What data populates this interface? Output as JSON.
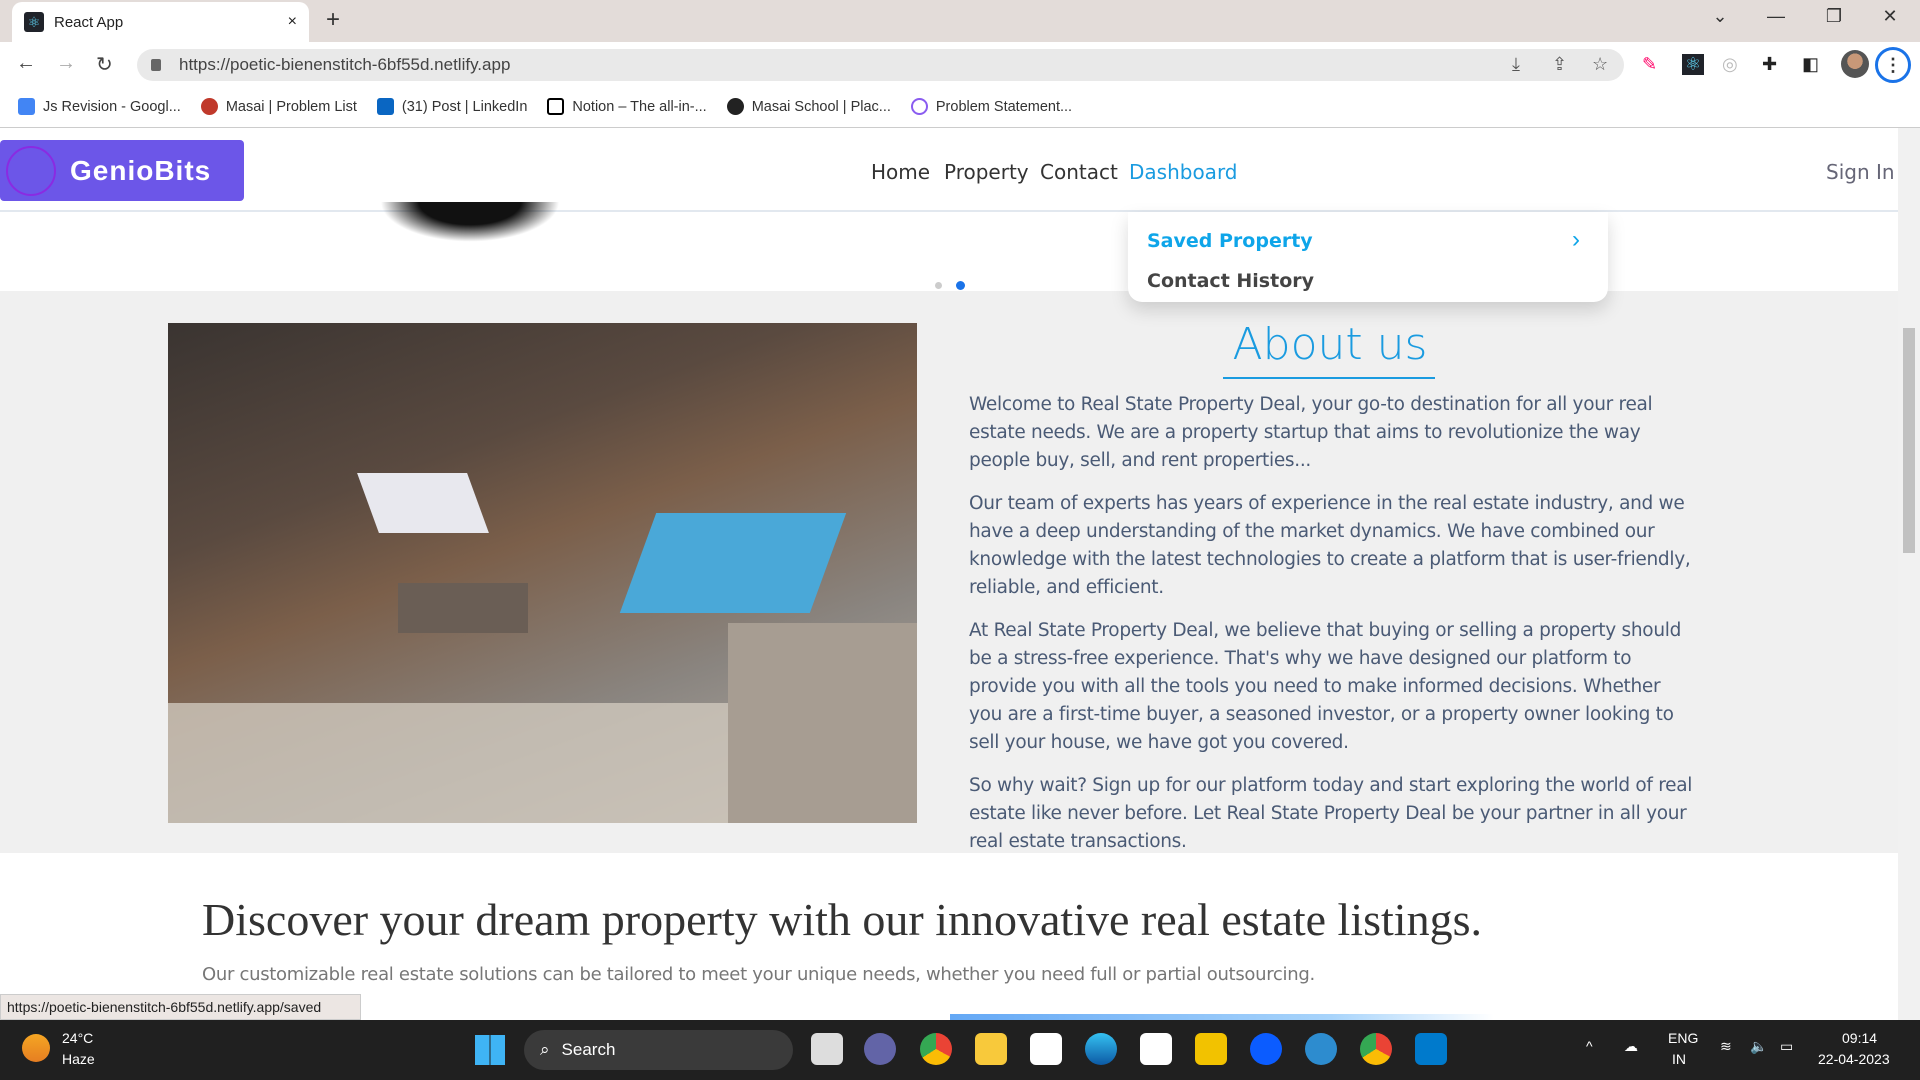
{
  "browser": {
    "tab_title": "React App",
    "tab_close": "×",
    "new_tab": "+",
    "url": "https://poetic-bienenstitch-6bf55d.netlify.app",
    "status_url": "https://poetic-bienenstitch-6bf55d.netlify.app/saved",
    "bookmarks": [
      {
        "label": "Js Revision - Googl...",
        "icon": "google-docs-icon",
        "color": "#4285f4"
      },
      {
        "label": "Masai | Problem List",
        "icon": "masai-icon",
        "color": "#c0392b"
      },
      {
        "label": "(31) Post | LinkedIn",
        "icon": "linkedin-icon",
        "color": "#0a66c2"
      },
      {
        "label": "Notion – The all-in-...",
        "icon": "notion-icon",
        "color": "#000000"
      },
      {
        "label": "Masai School | Plac...",
        "icon": "globe-icon",
        "color": "#222222"
      },
      {
        "label": "Problem Statement...",
        "icon": "network-icon",
        "color": "#8a5cf0"
      }
    ]
  },
  "site": {
    "logo": "GenioBits",
    "nav": [
      {
        "label": "Home"
      },
      {
        "label": "Property"
      },
      {
        "label": "Contact"
      },
      {
        "label": "Dashboard",
        "active": true
      }
    ],
    "sign_in": "Sign In",
    "dropdown": {
      "items": [
        {
          "label": "Saved Property",
          "chevron": "›"
        },
        {
          "label": "Contact History"
        }
      ]
    },
    "carousel": {
      "slides": 2,
      "active": 2
    },
    "about": {
      "title": "About us",
      "paragraphs": [
        "Welcome to Real State Property Deal, your go-to destination for all your real estate needs. We are a property startup that aims to revolutionize the way people buy, sell, and rent properties...",
        "Our team of experts has years of experience in the real estate industry, and we have a deep understanding of the market dynamics. We have combined our knowledge with the latest technologies to create a platform that is user-friendly, reliable, and efficient.",
        "At Real State Property Deal, we believe that buying or selling a property should be a stress-free experience. That's why we have designed our platform to provide you with all the tools you need to make informed decisions. Whether you are a first-time buyer, a seasoned investor, or a property owner looking to sell your house, we have got you covered.",
        "So why wait? Sign up for our platform today and start exploring the world of real estate like never before. Let Real State Property Deal be your partner in all your real estate transactions."
      ]
    },
    "listing": {
      "heading": "Discover your dream property with our innovative real estate listings.",
      "subtext": "Our customizable real estate solutions can be tailored to meet your unique needs, whether you need full or partial outsourcing."
    },
    "colors": {
      "accent": "#1a9be0",
      "logo_bg": "#6c56e8",
      "dropdown_active": "#0ea5e9"
    }
  },
  "taskbar": {
    "weather_temp": "24°C",
    "weather_desc": "Haze",
    "search": "Search",
    "lang1": "ENG",
    "lang2": "IN",
    "time": "09:14",
    "date": "22-04-2023"
  }
}
